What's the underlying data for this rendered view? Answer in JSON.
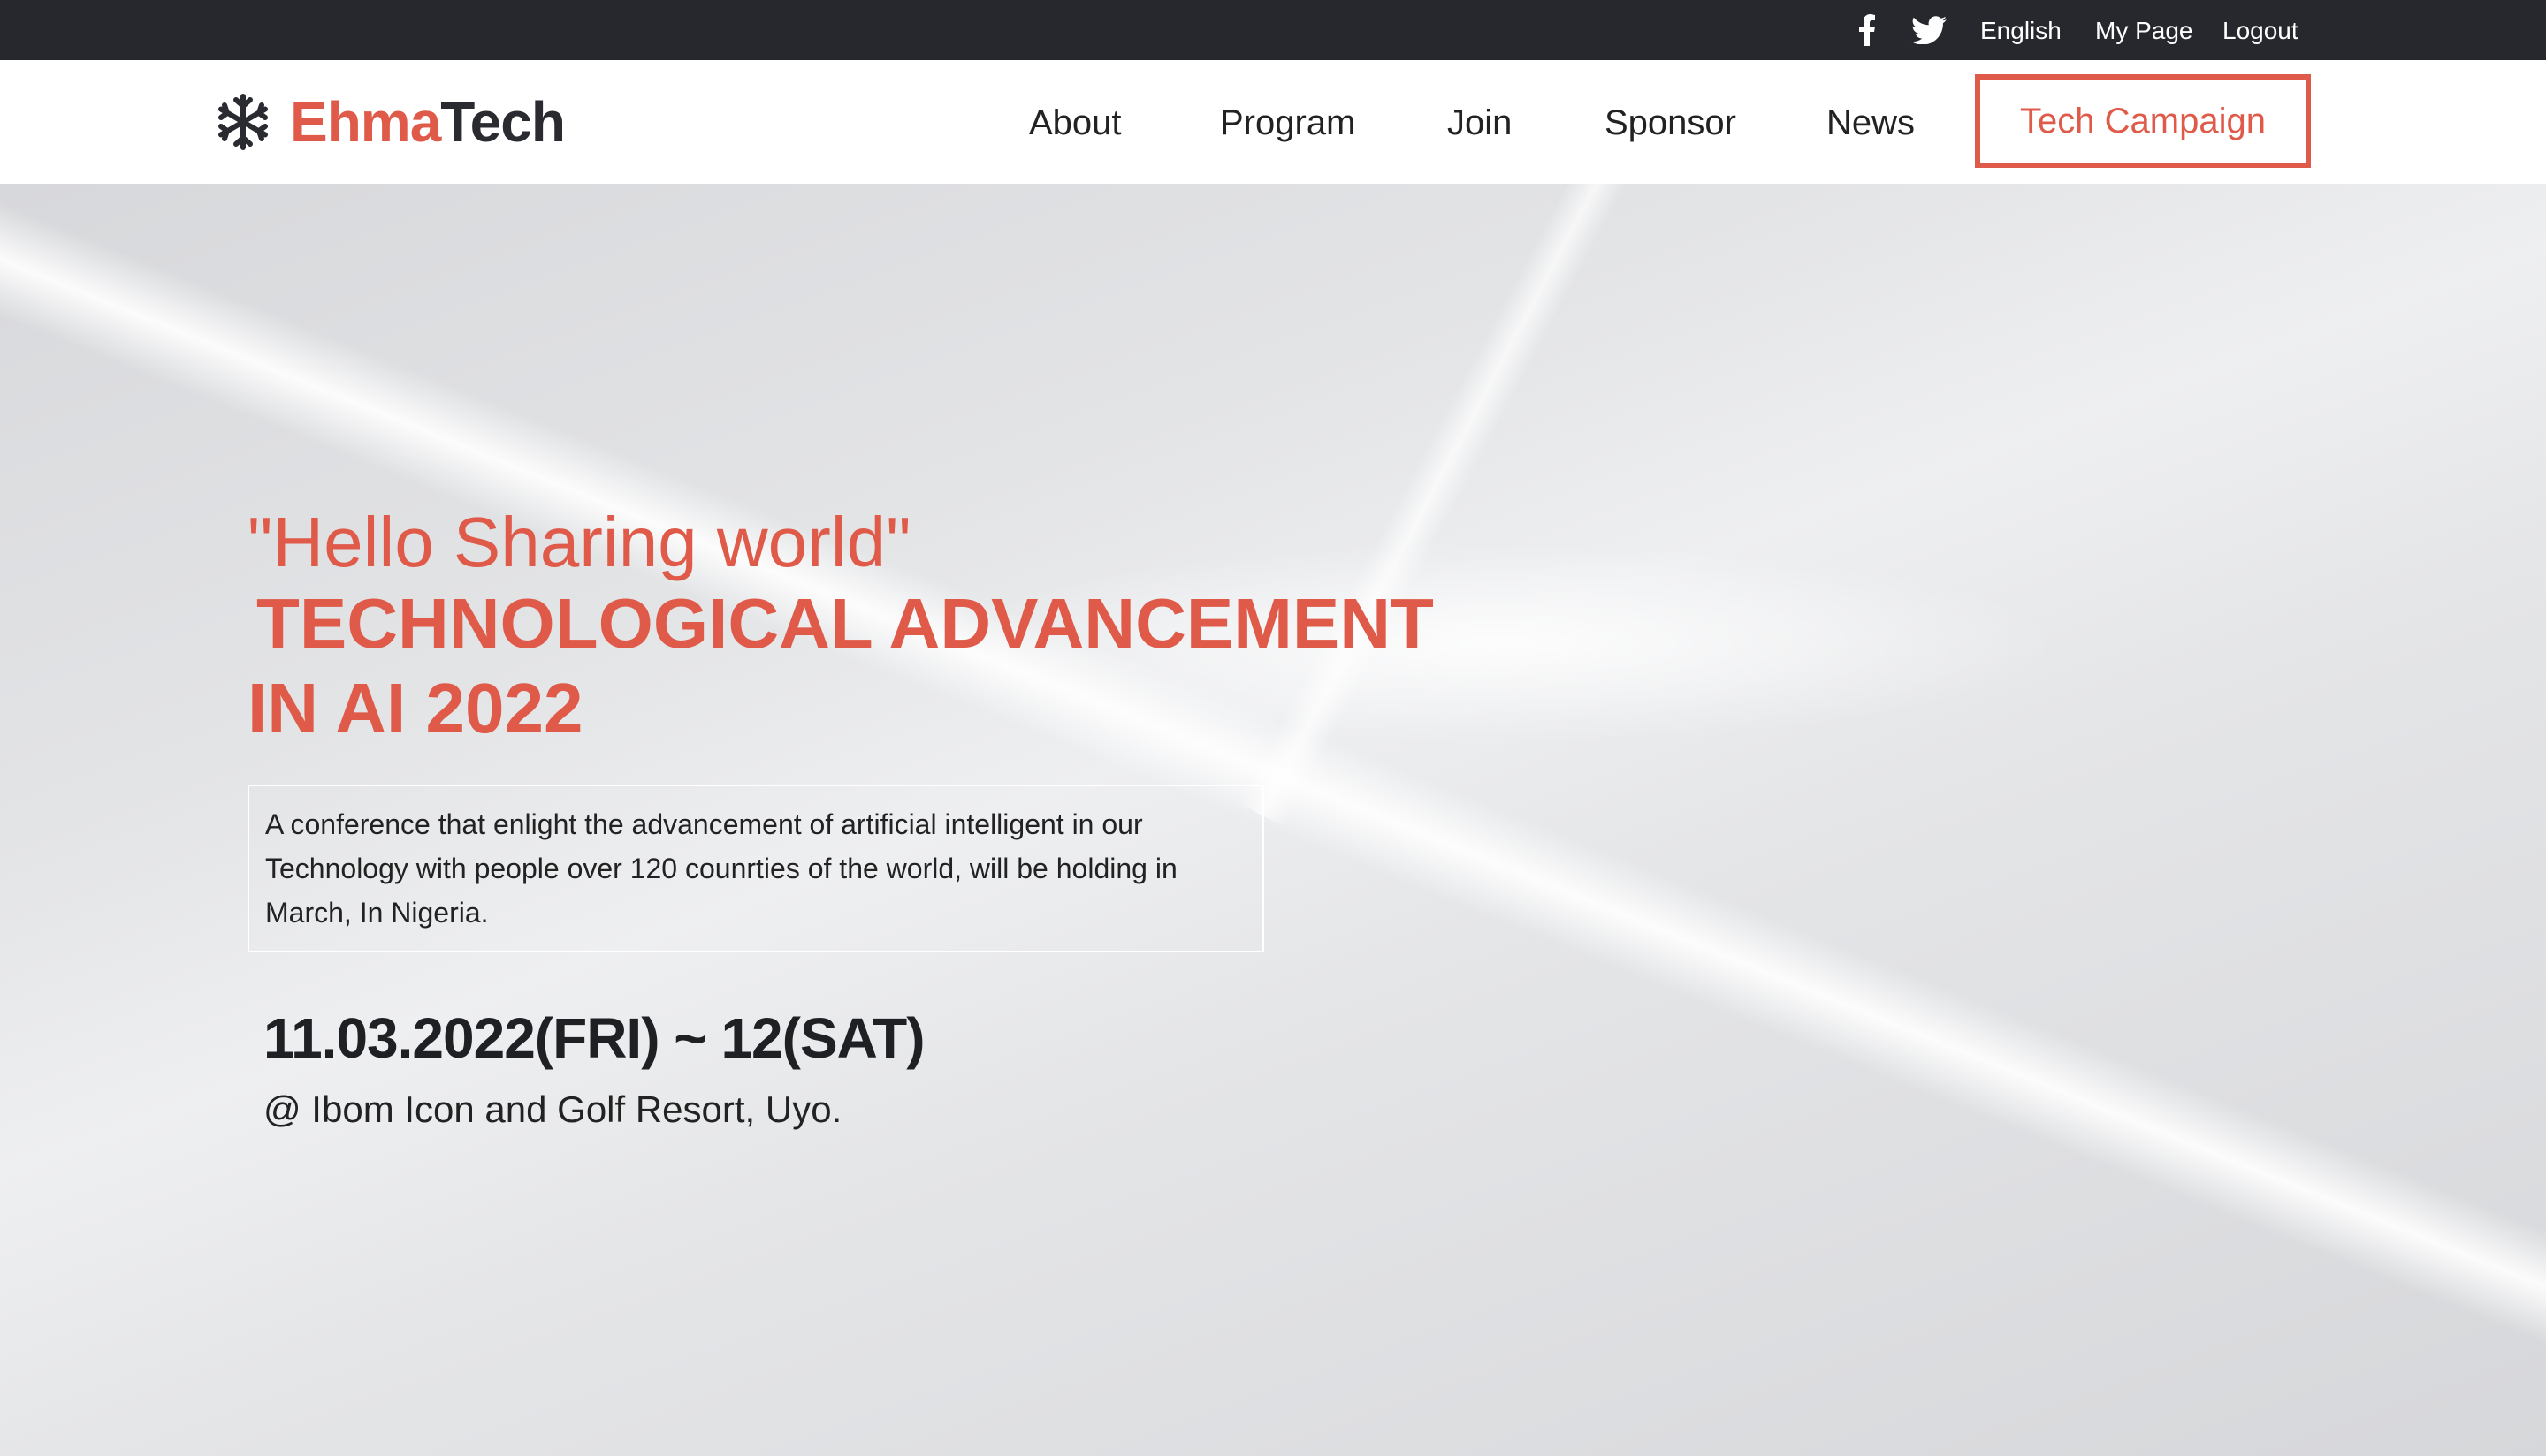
{
  "topbar": {
    "social": [
      {
        "name": "facebook-icon"
      },
      {
        "name": "twitter-icon"
      }
    ],
    "language": "English",
    "my_page": "My Page",
    "logout": "Logout"
  },
  "brand": {
    "name_part1": "Ehma",
    "name_part2": "Tech",
    "icon": "snowflake-icon",
    "accent_color": "#df5a49",
    "dark_color": "#2a2b30"
  },
  "nav": {
    "about": "About",
    "program": "Program",
    "join": "Join",
    "sponsor": "Sponsor",
    "news": "News",
    "campaign": "Tech Campaign"
  },
  "hero": {
    "tagline": "\"Hello Sharing world\"",
    "headline_line1": "TECHNOLOGICAL ADVANCEMENT",
    "headline_line2": "IN AI 2022",
    "description": "A conference that enlight the advancement of artificial intelligent in our Technology with people over 120 counrties of the world, will be holding in March, In Nigeria.",
    "date": "11.03.2022(FRI) ~ 12(SAT)",
    "venue": "@ Ibom Icon and Golf Resort, Uyo."
  }
}
